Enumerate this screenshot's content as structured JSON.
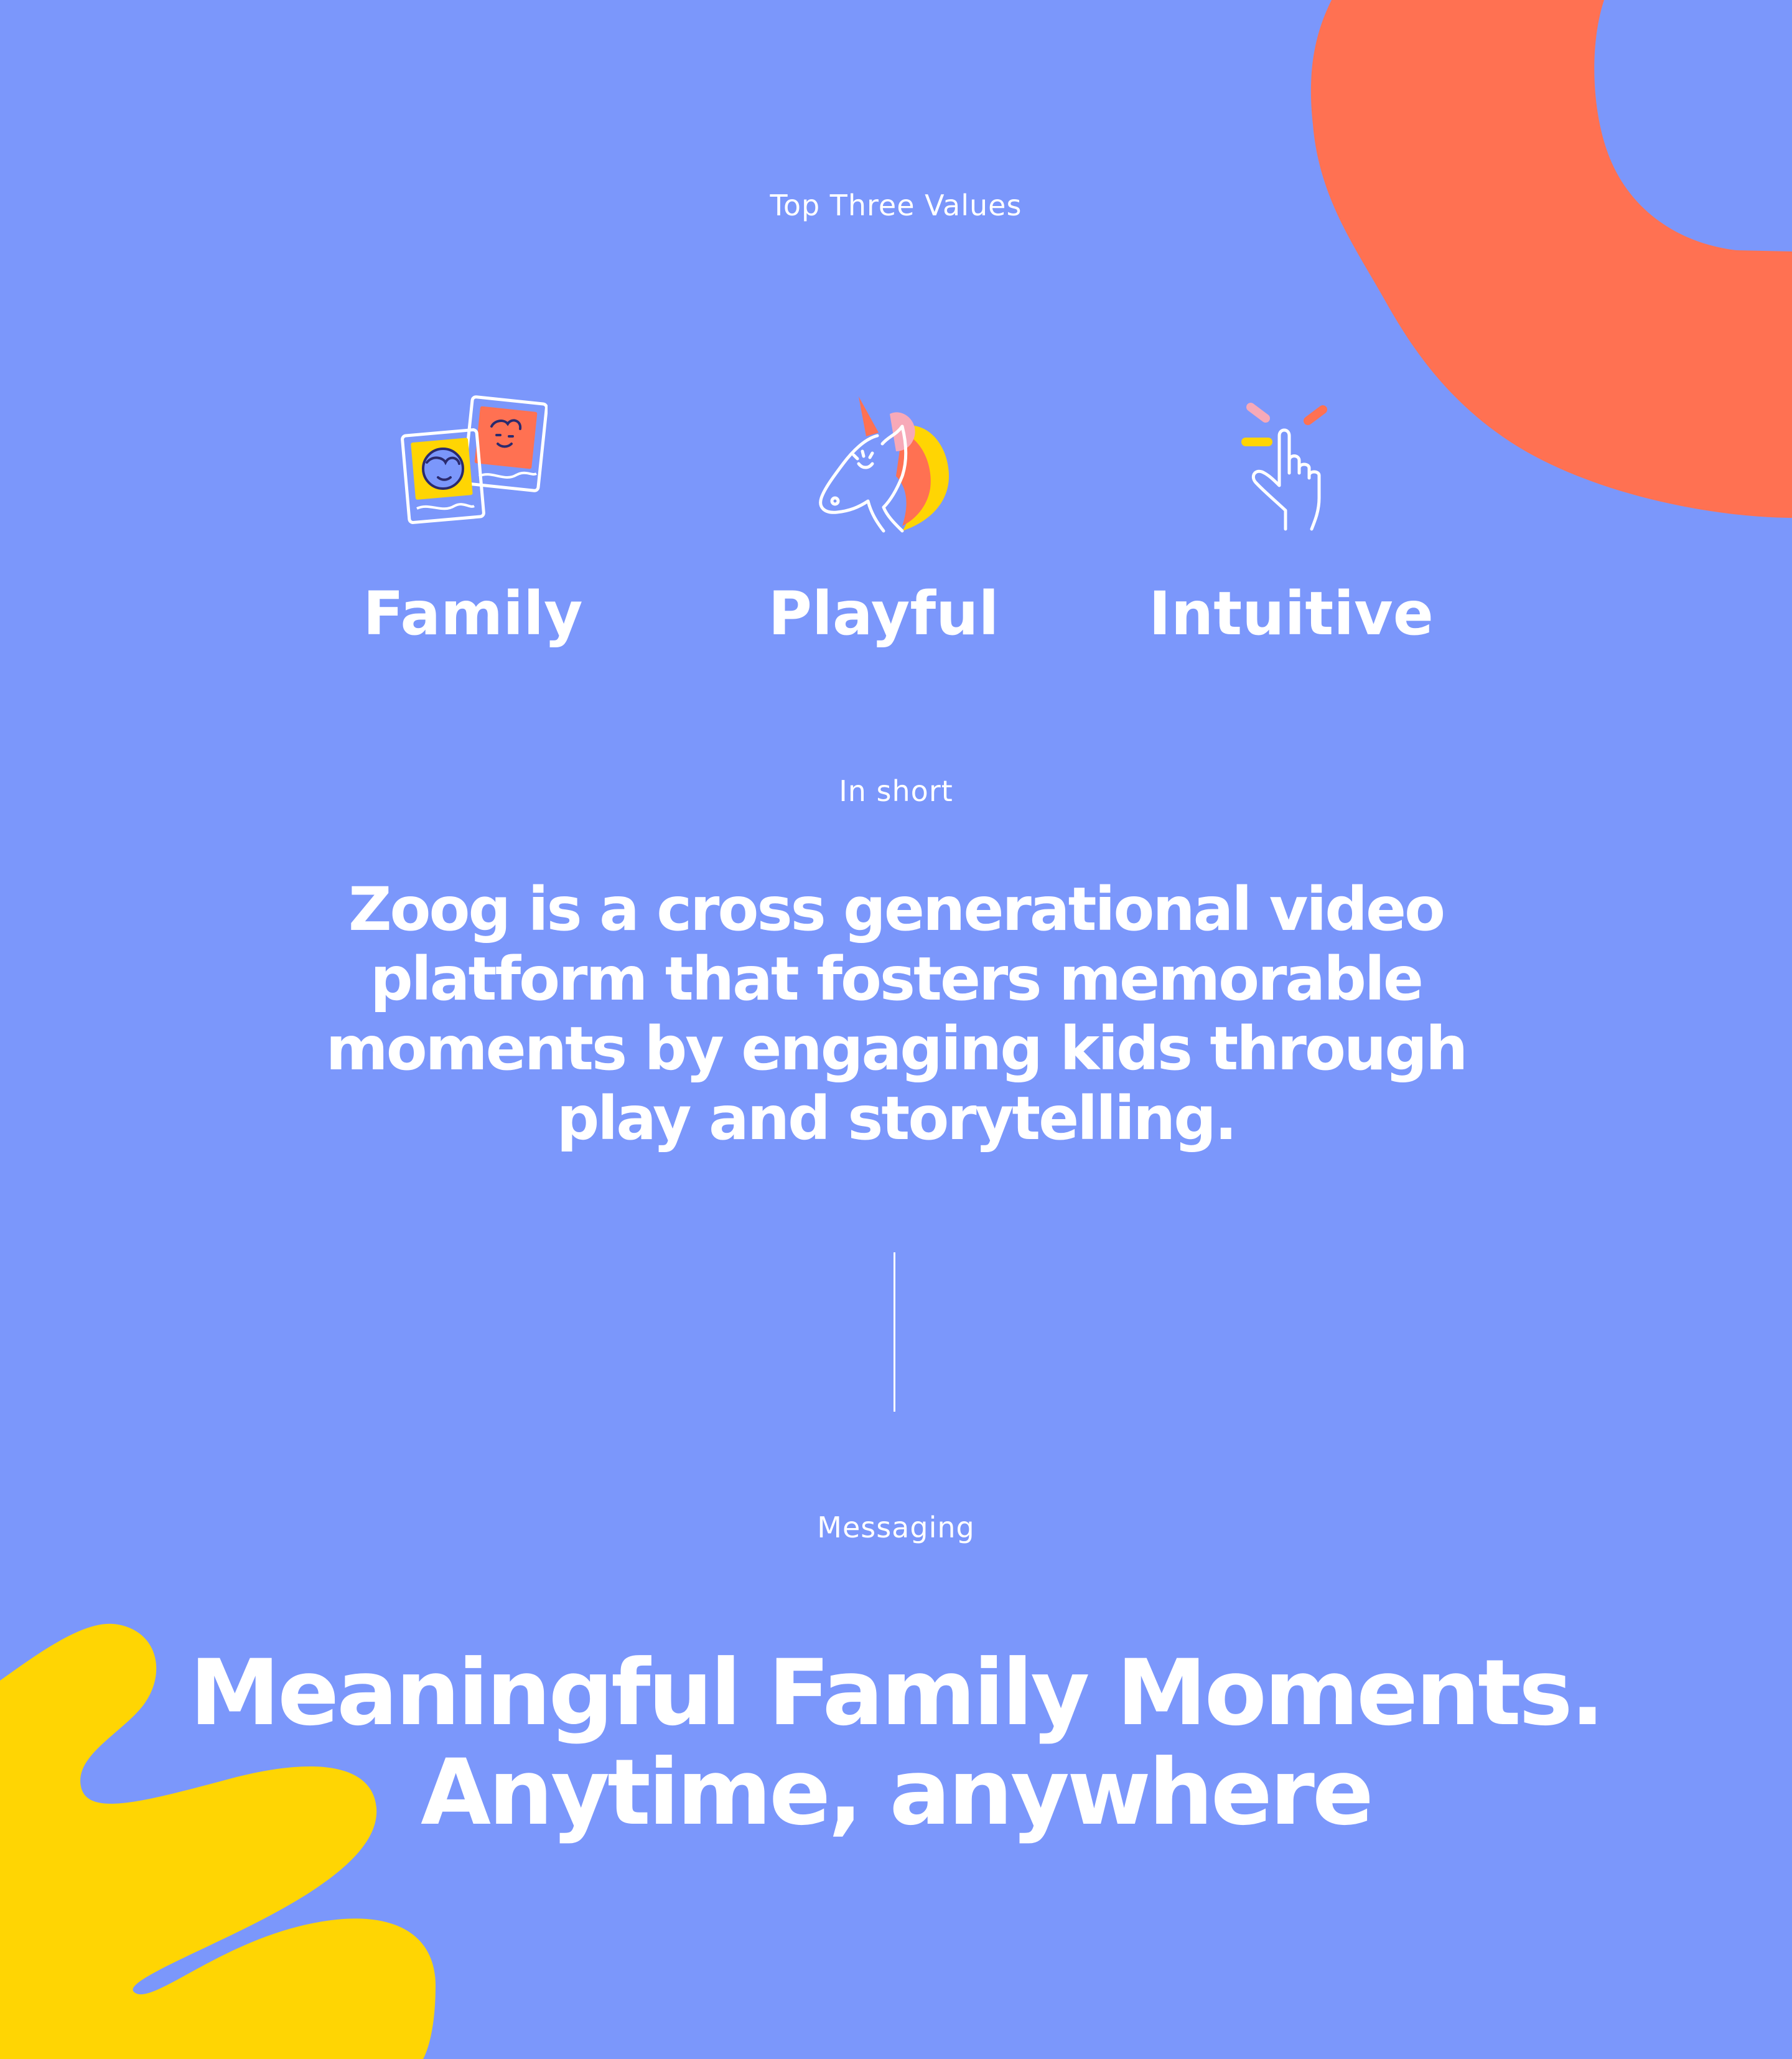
{
  "colors": {
    "background": "#7b97fb",
    "accent_orange": "#ff7152",
    "accent_yellow": "#ffd503",
    "text": "#ffffff"
  },
  "values_section": {
    "eyebrow": "Top Three Values",
    "items": [
      {
        "label": "Family",
        "icon": "photo-frames-icon"
      },
      {
        "label": "Playful",
        "icon": "unicorn-icon"
      },
      {
        "label": "Intuitive",
        "icon": "finger-snap-icon"
      }
    ]
  },
  "short_section": {
    "eyebrow": "In short",
    "statement": "Zoog is a cross generational video platform that fosters memorable moments by engaging kids through play and storytelling."
  },
  "messaging_section": {
    "eyebrow": "Messaging",
    "headline_line1": "Meaningful Family Moments.",
    "headline_line2": "Anytime, anywhere"
  }
}
